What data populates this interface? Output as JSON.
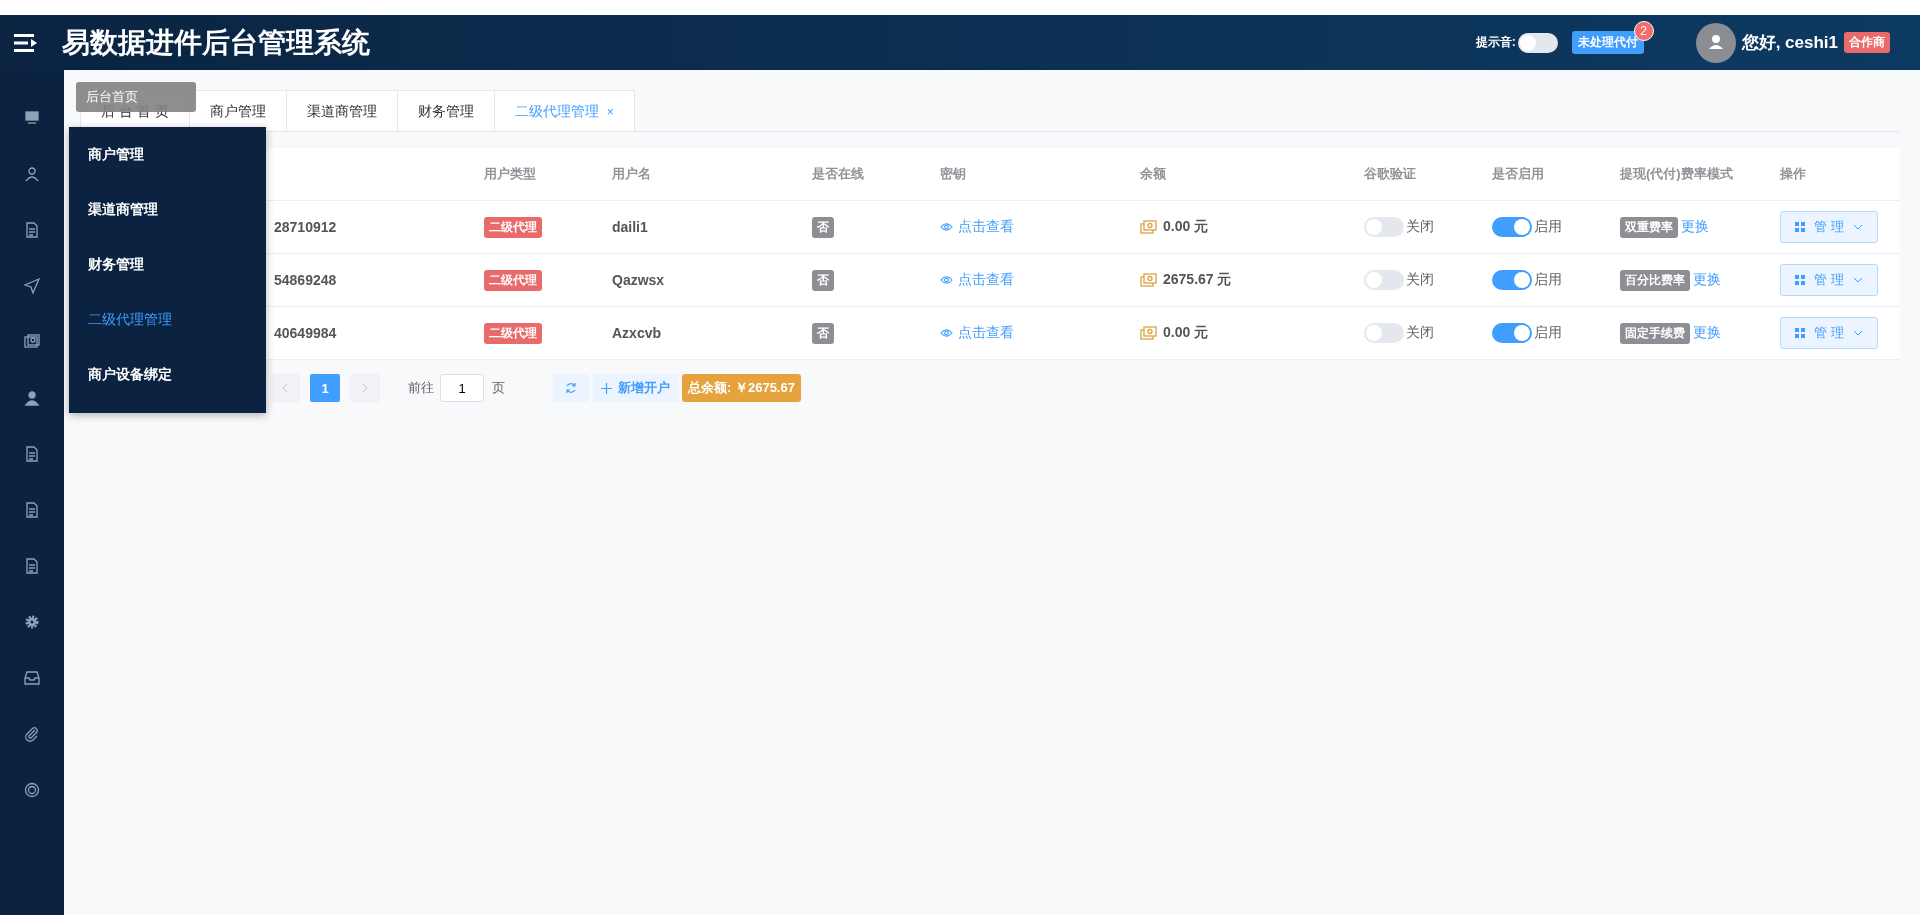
{
  "header": {
    "title": "易数据进件后台管理系统",
    "sound_label": "提示音:",
    "sound_on": false,
    "pending_label": "未处理代付",
    "pending_count": "2",
    "greeting": "您好, ceshi1",
    "role_tag": "合作商"
  },
  "tooltip": "后台首页",
  "tabs": [
    {
      "label": "后 台 首 页",
      "selected": false
    },
    {
      "label": "商户管理",
      "selected": false
    },
    {
      "label": "渠道商管理",
      "selected": false
    },
    {
      "label": "财务管理",
      "selected": false
    },
    {
      "label": "二级代理管理",
      "selected": true,
      "close": "×"
    }
  ],
  "flyout_menu": [
    {
      "label": "商户管理",
      "selected": false
    },
    {
      "label": "渠道商管理",
      "selected": false
    },
    {
      "label": "财务管理",
      "selected": false
    },
    {
      "label": "二级代理管理",
      "selected": true
    },
    {
      "label": "商户设备绑定",
      "selected": false
    }
  ],
  "table": {
    "columns": [
      "用户类型",
      "用户名",
      "是否在线",
      "密钥",
      "余额",
      "谷歌验证",
      "是否启用",
      "提现(代付)费率模式",
      "操作"
    ],
    "rows": [
      {
        "id": "28710912",
        "type": "二级代理",
        "username": "daili1",
        "online": "否",
        "key_link": "点击查看",
        "balance": "0.00 元",
        "google": {
          "on": false,
          "label": "关闭"
        },
        "enabled": {
          "on": true,
          "label": "启用"
        },
        "fee_mode": "双重费率",
        "change": "更换",
        "action": "管 理"
      },
      {
        "id": "54869248",
        "type": "二级代理",
        "username": "Qazwsx",
        "online": "否",
        "key_link": "点击查看",
        "balance": "2675.67 元",
        "google": {
          "on": false,
          "label": "关闭"
        },
        "enabled": {
          "on": true,
          "label": "启用"
        },
        "fee_mode": "百分比费率",
        "change": "更换",
        "action": "管 理"
      },
      {
        "id": "40649984",
        "type": "二级代理",
        "username": "Azxcvb",
        "online": "否",
        "key_link": "点击查看",
        "balance": "0.00 元",
        "google": {
          "on": false,
          "label": "关闭"
        },
        "enabled": {
          "on": true,
          "label": "启用"
        },
        "fee_mode": "固定手续费",
        "change": "更换",
        "action": "管 理"
      }
    ]
  },
  "pagination": {
    "page": "1",
    "goto_label": "前往",
    "goto_value": "1",
    "page_suffix": "页",
    "add_label": "新增开户",
    "total": "总余额: ￥2675.67"
  }
}
